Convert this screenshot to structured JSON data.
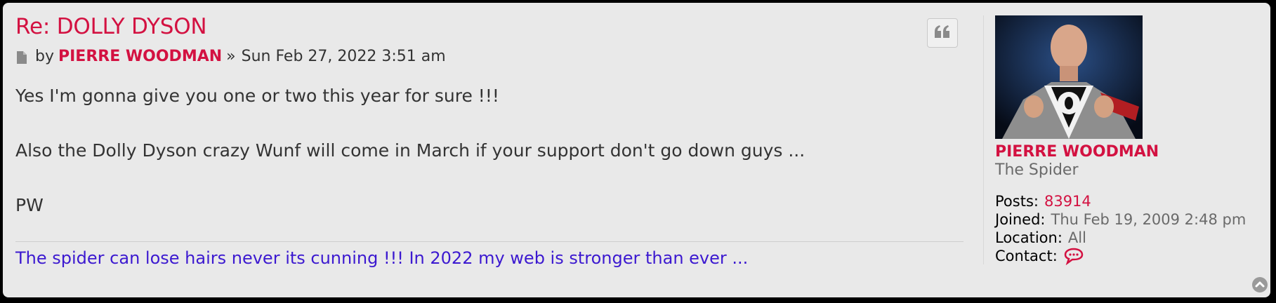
{
  "post": {
    "title": "Re: DOLLY DYSON",
    "by_label": "by",
    "author": "PIERRE WOODMAN",
    "separator": "»",
    "date": "Sun Feb 27, 2022 3:51 am",
    "content": [
      "Yes I'm gonna give you one or two this year for sure !!!",
      "Also the Dolly Dyson crazy Wunf will come in March if your support don't go down guys ...",
      "PW"
    ],
    "signature": "The spider can lose hairs never its cunning !!! In 2022 my web is stronger than ever ...",
    "quote_icon": "quote-icon",
    "post_icon": "document-icon"
  },
  "profile": {
    "avatar_alt": "avatar",
    "username": "PIERRE WOODMAN",
    "rank": "The Spider",
    "posts_label": "Posts:",
    "posts_value": "83914",
    "joined_label": "Joined:",
    "joined_value": "Thu Feb 19, 2009 2:48 pm",
    "location_label": "Location:",
    "location_value": "All",
    "contact_label": "Contact:",
    "contact_icon": "speech-bubble-icon"
  },
  "back_to_top_icon": "chevron-up-circle-icon",
  "colors": {
    "accent": "#d31141",
    "signature": "#3c19d0",
    "panel": "#e9e9e9",
    "text": "#333333"
  }
}
